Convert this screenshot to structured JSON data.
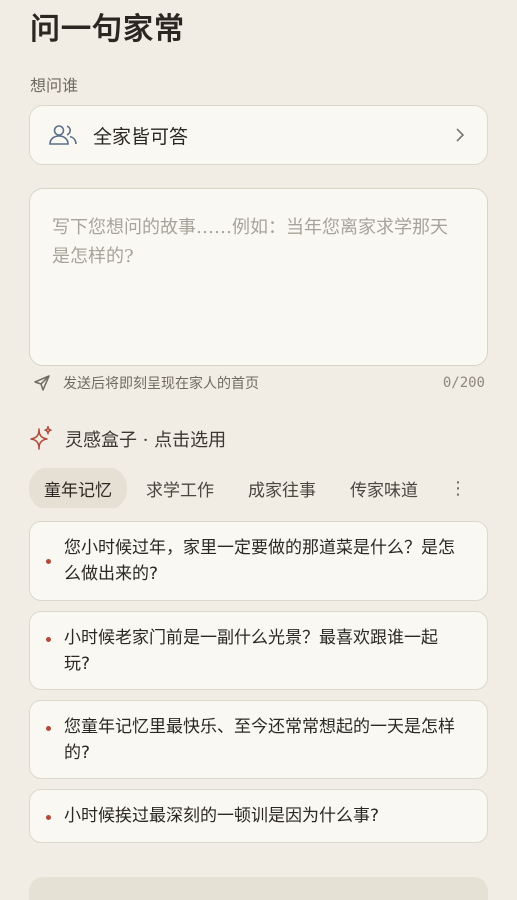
{
  "page": {
    "title": "问一句家常"
  },
  "recipient": {
    "section_label": "想问谁",
    "label": "全家皆可答",
    "icon": "people-icon"
  },
  "question_input": {
    "placeholder": "写下您想问的故事……例如：当年您离家求学那天是怎样的?",
    "value": ""
  },
  "hint": {
    "text": "发送后将即刻呈现在家人的首页",
    "counter": "0/200"
  },
  "inspiration": {
    "title": "灵感盒子 · 点击选用",
    "tabs": [
      {
        "label": "童年记忆",
        "active": true
      },
      {
        "label": "求学工作",
        "active": false
      },
      {
        "label": "成家往事",
        "active": false
      },
      {
        "label": "传家味道",
        "active": false
      }
    ],
    "more_glyph": "⋮",
    "questions": [
      "您小时候过年，家里一定要做的那道菜是什么？是怎么做出来的?",
      "小时候老家门前是一副什么光景？最喜欢跟谁一起玩?",
      "您童年记忆里最快乐、至今还常常想起的一天是怎样的?",
      "小时候挨过最深刻的一顿训是因为什么事?"
    ]
  },
  "colors": {
    "background": "#f1ede4",
    "accent": "#b04a3a",
    "card": "#faf8f3",
    "active_tab": "#e5e0d3"
  }
}
